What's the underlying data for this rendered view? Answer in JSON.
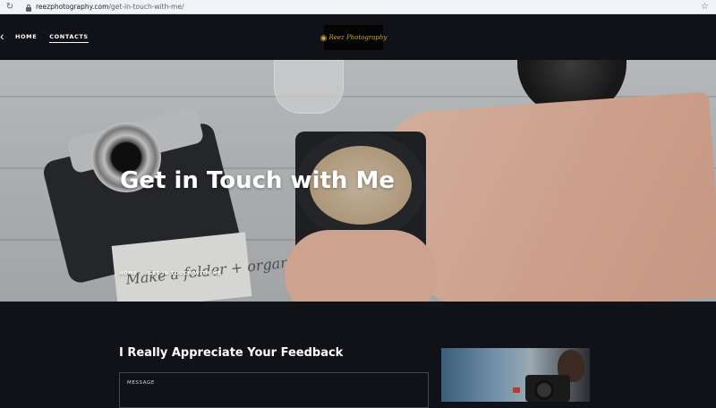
{
  "browser": {
    "reload_icon": "reload-icon",
    "url_domain": "reezphotography.com",
    "url_path": "/get-in-touch-with-me/",
    "star_icon": "star-icon"
  },
  "header": {
    "back_icon": "chevron-left-icon",
    "nav": [
      {
        "label": "HOME",
        "active": false
      },
      {
        "label": "CONTACTS",
        "active": true
      }
    ],
    "logo_text": "Reez Photography"
  },
  "hero": {
    "title": "Get in Touch with Me",
    "breadcrumb": [
      "HOME",
      "/",
      "GET IN TOUCH WITH ME"
    ],
    "note_text": "Make a folder + organize"
  },
  "main": {
    "section_title": "I Really Appreciate Your Feedback",
    "message_label": "MESSAGE"
  },
  "colors": {
    "background": "#111217",
    "accent_gold": "#c9a441",
    "text": "#ffffff"
  }
}
